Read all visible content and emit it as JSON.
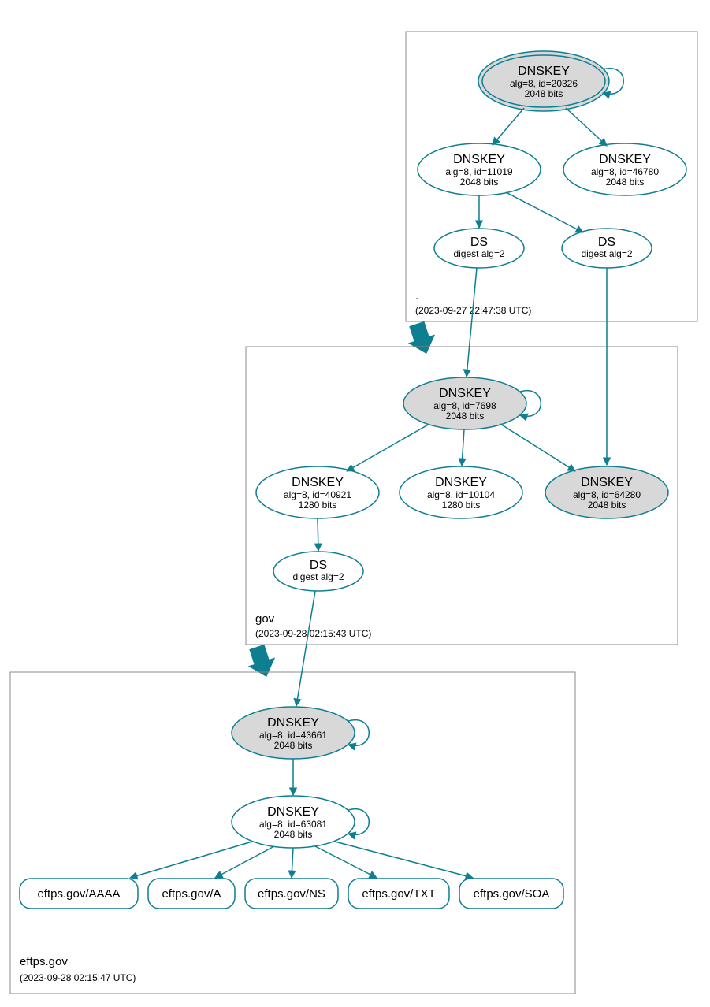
{
  "zones": {
    "root": {
      "name": ".",
      "timestamp": "(2023-09-27 22:47:38 UTC)"
    },
    "gov": {
      "name": "gov",
      "timestamp": "(2023-09-28 02:15:43 UTC)"
    },
    "eftps": {
      "name": "eftps.gov",
      "timestamp": "(2023-09-28 02:15:47 UTC)"
    }
  },
  "nodes": {
    "root_ksk": {
      "title": "DNSKEY",
      "line1": "alg=8, id=20326",
      "line2": "2048 bits"
    },
    "root_zsk1": {
      "title": "DNSKEY",
      "line1": "alg=8, id=11019",
      "line2": "2048 bits"
    },
    "root_zsk2": {
      "title": "DNSKEY",
      "line1": "alg=8, id=46780",
      "line2": "2048 bits"
    },
    "root_ds1": {
      "title": "DS",
      "line1": "digest alg=2"
    },
    "root_ds2": {
      "title": "DS",
      "line1": "digest alg=2"
    },
    "gov_ksk": {
      "title": "DNSKEY",
      "line1": "alg=8, id=7698",
      "line2": "2048 bits"
    },
    "gov_zsk1": {
      "title": "DNSKEY",
      "line1": "alg=8, id=40921",
      "line2": "1280 bits"
    },
    "gov_zsk2": {
      "title": "DNSKEY",
      "line1": "alg=8, id=10104",
      "line2": "1280 bits"
    },
    "gov_zsk3": {
      "title": "DNSKEY",
      "line1": "alg=8, id=64280",
      "line2": "2048 bits"
    },
    "gov_ds": {
      "title": "DS",
      "line1": "digest alg=2"
    },
    "eftps_ksk": {
      "title": "DNSKEY",
      "line1": "alg=8, id=43661",
      "line2": "2048 bits"
    },
    "eftps_zsk": {
      "title": "DNSKEY",
      "line1": "alg=8, id=63081",
      "line2": "2048 bits"
    }
  },
  "records": {
    "aaaa": "eftps.gov/AAAA",
    "a": "eftps.gov/A",
    "ns": "eftps.gov/NS",
    "txt": "eftps.gov/TXT",
    "soa": "eftps.gov/SOA"
  }
}
